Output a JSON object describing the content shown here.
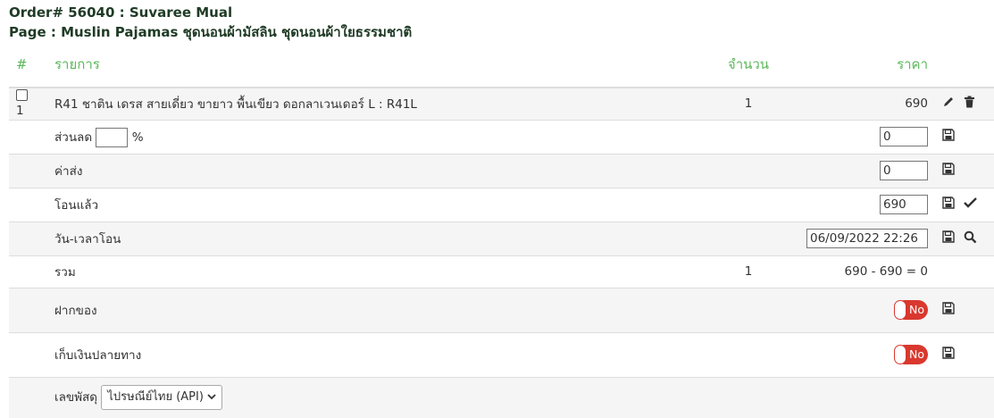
{
  "header": {
    "order_line": "Order# 56040 : Suvaree Mual",
    "page_line": "Page : Muslin Pajamas ชุดนอนผ้ามัสลิน ชุดนอนผ้าใยธรรมชาติ"
  },
  "table": {
    "col_num": "#",
    "col_item": "รายการ",
    "col_qty": "จำนวน",
    "col_price": "ราคา"
  },
  "item": {
    "index": "1",
    "name": "R41 ชาติน เดรส สายเดี่ยว ขายาว พื้นเขียว ดอกลาเวนเดอร์ L : R41L",
    "qty": "1",
    "price": "690"
  },
  "discount": {
    "label": "ส่วนลด",
    "unit": "%",
    "percent_value": "",
    "value": "0"
  },
  "shipping": {
    "label": "ค่าส่ง",
    "value": "0"
  },
  "transferred": {
    "label": "โอนแล้ว",
    "value": "690"
  },
  "transfer_time": {
    "label": "วัน-เวลาโอน",
    "value": "06/09/2022 22:26"
  },
  "total": {
    "label": "รวม",
    "qty": "1",
    "formula": "690 - 690 = 0"
  },
  "deposit": {
    "label": "ฝากของ",
    "toggle": "No"
  },
  "cod": {
    "label": "เก็บเงินปลายทาง",
    "toggle": "No"
  },
  "tracking": {
    "label": "เลขพัสดุ",
    "carrier": "ไปรษณีย์ไทย (API)"
  },
  "colors": {
    "accent": "#5cb85c",
    "toggle_off": "#d9382e",
    "header": "#1f3b25"
  }
}
